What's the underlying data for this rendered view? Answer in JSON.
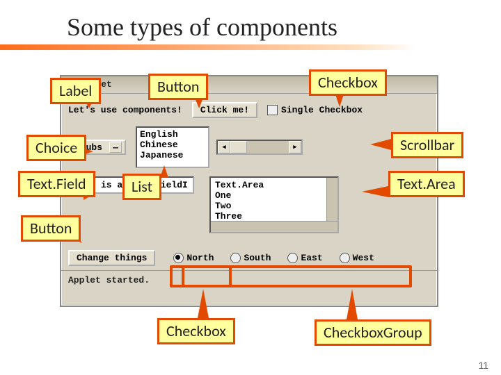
{
  "slide": {
    "title": "Some types of components",
    "page_number": "11"
  },
  "applet": {
    "window_title": "Applet",
    "label_text": "Let's use components!",
    "button_label": "Click me!",
    "checkbox_label": "Single Checkbox",
    "choice_selected": "Clubs",
    "list_items": [
      "English",
      "Chinese",
      "Japanese"
    ],
    "textfield_value": "This is a Text.Field",
    "textarea_lines": [
      "Text.Area",
      "One",
      "Two",
      "Three"
    ],
    "change_button_label": "Change things",
    "radios": [
      "North",
      "South",
      "East",
      "West"
    ],
    "radio_selected": 0,
    "status_text": "Applet started."
  },
  "callouts": {
    "label": "Label",
    "button_top": "Button",
    "checkbox_top": "Checkbox",
    "choice": "Choice",
    "scrollbar": "Scrollbar",
    "textfield": "Text.Field",
    "list": "List",
    "textarea": "Text.Area",
    "button_left": "Button",
    "checkbox_bottom": "Checkbox",
    "checkboxgroup": "CheckboxGroup"
  }
}
